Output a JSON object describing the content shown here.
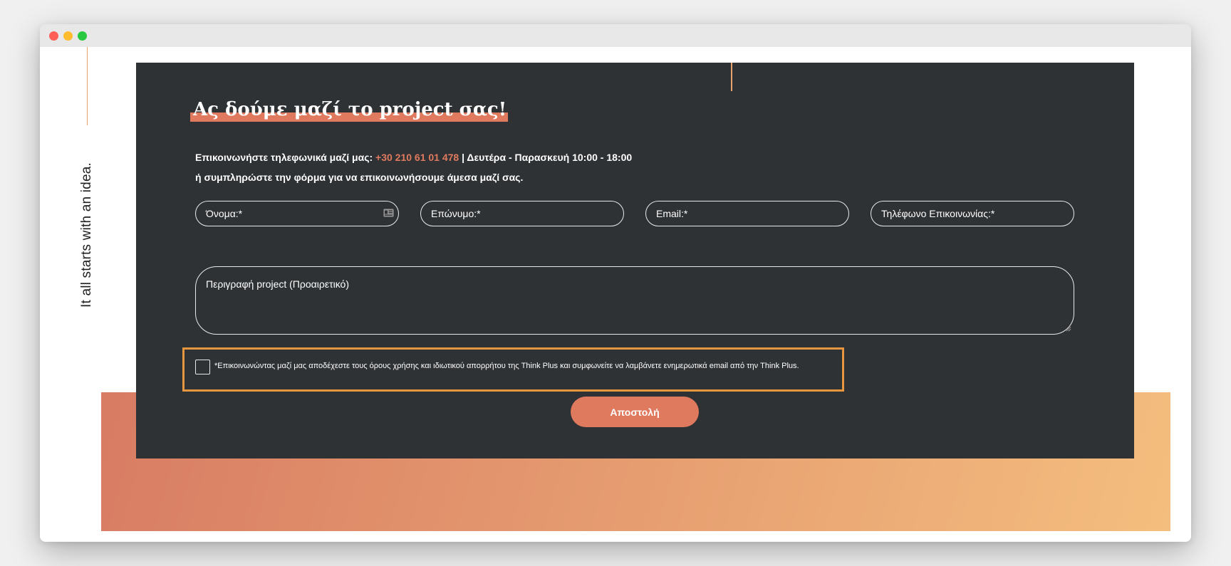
{
  "window": {
    "controls": [
      "close",
      "minimize",
      "maximize"
    ]
  },
  "tagline": "It all starts with an idea.",
  "contact": {
    "heading": "Ας δούμε μαζί το project σας!",
    "phone_prefix": "Επικοινωνήστε τηλεφωνικά μαζί μας: ",
    "phone_number": "+30 210 61 01 478",
    "hours": " | Δευτέρα - Παρασκευή 10:00 - 18:00",
    "form_hint": "ή συμπληρώστε την φόρμα για να επικοινωνήσουμε άμεσα μαζί σας.",
    "fields": {
      "first_name": "Όνομα:*",
      "last_name": "Επώνυμο:*",
      "email": "Email:*",
      "phone": "Τηλέφωνο Επικοινωνίας:*",
      "description": "Περιγραφή project (Προαιρετικό)"
    },
    "consent": {
      "checked": false,
      "text": "*Επικοινωνώντας μαζί μας αποδέχεστε τους όρους χρήσης και ιδιωτικού απορρήτου της Think Plus και συμφωνείτε να λαμβάνετε ενημερωτικά email από την Think Plus."
    },
    "submit_label": "Αποστολή"
  },
  "colors": {
    "panel": "#2f3235",
    "accent": "#e07a5f",
    "accent_line": "#e7a36d",
    "consent_outline": "#e5963e",
    "gradient_start": "#d87c63",
    "gradient_end": "#f4be7e",
    "dot_red": "#fe5f57",
    "dot_yellow": "#febc2e",
    "dot_green": "#28c840"
  },
  "icons": {
    "first_name_field": "contact-card-icon",
    "textarea_corner": "resize-handle-icon"
  }
}
